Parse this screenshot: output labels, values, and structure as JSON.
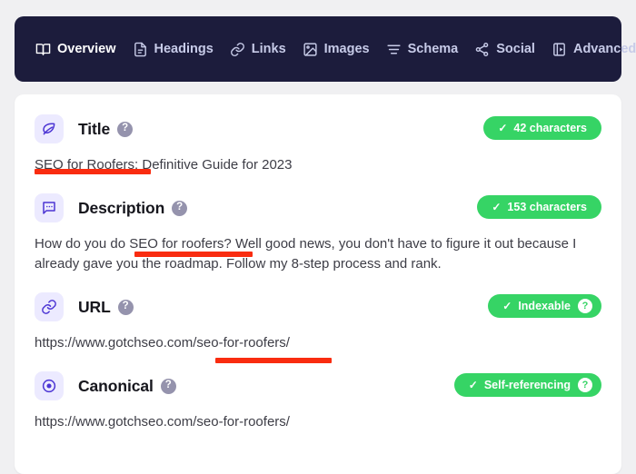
{
  "navbar": {
    "items": [
      {
        "label": "Overview",
        "icon": "book-icon",
        "active": true
      },
      {
        "label": "Headings",
        "icon": "document-icon",
        "active": false
      },
      {
        "label": "Links",
        "icon": "link-icon",
        "active": false
      },
      {
        "label": "Images",
        "icon": "image-icon",
        "active": false
      },
      {
        "label": "Schema",
        "icon": "list-icon",
        "active": false
      },
      {
        "label": "Social",
        "icon": "share-icon",
        "active": false
      },
      {
        "label": "Advanced",
        "icon": "advanced-icon",
        "active": false
      }
    ],
    "settings_icon": "sliders-icon",
    "background_color": "#1c1c3c",
    "active_text_color": "#ffffff",
    "inactive_text_color": "#c7cbe8"
  },
  "sections": [
    {
      "title": "Title",
      "icon": "leaf-icon",
      "help": "?",
      "badge": {
        "check": "✓",
        "label": "42 characters",
        "has_help": false,
        "help": "?"
      },
      "body": "SEO for Roofers: Definitive Guide for 2023"
    },
    {
      "title": "Description",
      "icon": "speech-bubble-icon",
      "help": "?",
      "badge": {
        "check": "✓",
        "label": "153 characters",
        "has_help": false,
        "help": "?"
      },
      "body": "How do you do SEO for roofers? Well good news, you don't have to figure it out because I already gave you the roadmap. Follow my 8-step process and rank."
    },
    {
      "title": "URL",
      "icon": "link-chain-icon",
      "help": "?",
      "badge": {
        "check": "✓",
        "label": "Indexable",
        "has_help": true,
        "help": "?"
      },
      "body": "https://www.gotchseo.com/seo-for-roofers/"
    },
    {
      "title": "Canonical",
      "icon": "target-icon",
      "help": "?",
      "badge": {
        "check": "✓",
        "label": "Self-referencing",
        "has_help": true,
        "help": "?"
      },
      "body": "https://www.gotchseo.com/seo-for-roofers/"
    }
  ],
  "annotations": {
    "highlight_color": "#f92c10",
    "marks": [
      {
        "target": "title-body",
        "covers": "SEO for"
      },
      {
        "target": "description-body",
        "covers": "SEO for roofers"
      },
      {
        "target": "url-body",
        "covers": "seo-for-roofers"
      }
    ]
  },
  "theme": {
    "page_background": "#f0f0f2",
    "card_background": "#ffffff",
    "accent_purple": "#4c35d4",
    "icon_tile_background": "#eceaff",
    "badge_green": "#36d465",
    "help_gray": "#9593ad"
  }
}
